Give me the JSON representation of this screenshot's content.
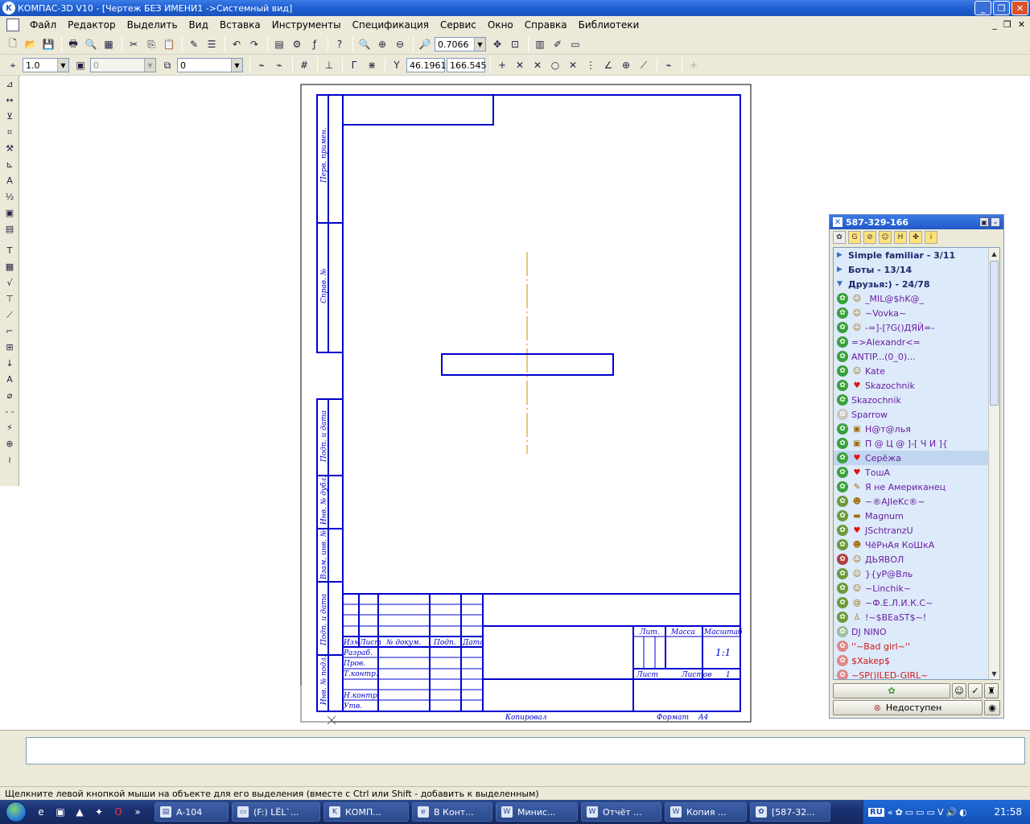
{
  "window": {
    "title": "КОМПАС-3D V10 - [Чертеж БЕЗ ИМЕНИ1 ->Системный вид]",
    "app_icon": "K"
  },
  "menu": [
    "Файл",
    "Редактор",
    "Выделить",
    "Вид",
    "Вставка",
    "Инструменты",
    "Спецификация",
    "Сервис",
    "Окно",
    "Справка",
    "Библиотеки"
  ],
  "toolbar1": {
    "zoom_value": "0.7066"
  },
  "toolbar2": {
    "step_value": "1.0",
    "layer_value": "0",
    "style_value": "0",
    "coord_x": "46.1961",
    "coord_y": "166.545"
  },
  "drawing": {
    "stamp": {
      "side_labels": [
        "Перв. примен.",
        "Справ. №",
        "Подп. и дата",
        "Инв. № дубл.",
        "Взам. инв. №",
        "Подп. и дата",
        "Инв. № подл."
      ],
      "rows": [
        "Изм",
        "Лист",
        "№ докум.",
        "Подп.",
        "Дата"
      ],
      "left_labels": [
        "Разраб.",
        "Пров.",
        "Т.контр.",
        "Н.контр.",
        "Утв."
      ],
      "lit": "Лит.",
      "mass": "Масса",
      "scale": "Масштаб",
      "scale_value": "1:1",
      "sheet": "Лист",
      "sheets": "Листов",
      "sheets_value": "1",
      "copied": "Копировал",
      "format": "Формат",
      "format_value": "A4"
    }
  },
  "status": {
    "hint": "Щелкните левой кнопкой мыши на объекте для его выделения (вместе с Ctrl или Shift - добавить к выделенным)"
  },
  "icq": {
    "uin": "587-329-166",
    "groups": [
      {
        "label": "Simple familiar - 3/11",
        "expanded": false
      },
      {
        "label": "Боты - 13/14",
        "expanded": false
      },
      {
        "label": "Друзья:) - 24/78",
        "expanded": true
      }
    ],
    "contacts": [
      {
        "name": "_MIL@$hK@_",
        "color": "#6a1ea0",
        "status": "#3aa03a",
        "xs": "☺"
      },
      {
        "name": "~Vovka~",
        "color": "#6a1ea0",
        "status": "#3aa03a",
        "xs": "☺"
      },
      {
        "name": "-=]-[?G()ДЯЙ=-",
        "color": "#6a1ea0",
        "status": "#3aa03a",
        "xs": "☺"
      },
      {
        "name": "=>Alexandr<=",
        "color": "#6a1ea0",
        "status": "#3aa03a",
        "xs": ""
      },
      {
        "name": "ANTIP...(0_0)...",
        "color": "#6a1ea0",
        "status": "#3aa03a",
        "xs": ""
      },
      {
        "name": "Kate",
        "color": "#6a1ea0",
        "status": "#3aa03a",
        "xs": "☺"
      },
      {
        "name": "Skazochnik",
        "color": "#6a1ea0",
        "status": "#3aa03a",
        "xs": "♥"
      },
      {
        "name": "Skazochnik",
        "color": "#6a1ea0",
        "status": "#3aa03a",
        "xs": ""
      },
      {
        "name": "Sparrow",
        "color": "#6a1ea0",
        "status": "#c8c8c0",
        "xs": ""
      },
      {
        "name": "Н@т@лья",
        "color": "#6a1ea0",
        "status": "#3aa03a",
        "xs": "▣"
      },
      {
        "name": "П @ Ц @ ]-[ Ч И ]{",
        "color": "#6a1ea0",
        "status": "#3aa03a",
        "xs": "▣"
      },
      {
        "name": "Серёжа",
        "color": "#6a1ea0",
        "status": "#3aa03a",
        "xs": "♥",
        "selected": true
      },
      {
        "name": "ТошА",
        "color": "#6a1ea0",
        "status": "#3aa03a",
        "xs": "♥"
      },
      {
        "name": "Я не Американец",
        "color": "#6a1ea0",
        "status": "#3aa03a",
        "xs": "✎"
      },
      {
        "name": "~®AJIeKc®~",
        "color": "#6a1ea0",
        "status": "#6a9a3a",
        "xs": "☻"
      },
      {
        "name": "Magnum",
        "color": "#6a1ea0",
        "status": "#6a9a3a",
        "xs": "▬"
      },
      {
        "name": "JSchtranzU",
        "color": "#6a1ea0",
        "status": "#6a9a3a",
        "xs": "♥"
      },
      {
        "name": "ЧёРнАя КоШкА",
        "color": "#6a1ea0",
        "status": "#6a9a3a",
        "xs": "☻"
      },
      {
        "name": "ДЬЯВОЛ",
        "color": "#6a1ea0",
        "status": "#b04040",
        "xs": "☺"
      },
      {
        "name": "}{уР@Вль",
        "color": "#6a1ea0",
        "status": "#6a9a3a",
        "xs": "☺"
      },
      {
        "name": "~Linchik~",
        "color": "#6a1ea0",
        "status": "#6a9a3a",
        "xs": "☺"
      },
      {
        "name": "~Ф.Е.Л.И.К.С~",
        "color": "#6a1ea0",
        "status": "#6a9a3a",
        "xs": "@"
      },
      {
        "name": "!~$BEaST$~!",
        "color": "#6a1ea0",
        "status": "#6a9a3a",
        "xs": "♙"
      },
      {
        "name": "DJ NINO",
        "color": "#6a1ea0",
        "status": "#a0c0a0",
        "xs": ""
      },
      {
        "name": "''~Bad girl~''",
        "color": "#d01818",
        "status": "#e08888",
        "xs": ""
      },
      {
        "name": "$Xakep$",
        "color": "#d01818",
        "status": "#e08888",
        "xs": ""
      },
      {
        "name": "~SP()ILED-GIRL~",
        "color": "#d01818",
        "status": "#e08888",
        "xs": ""
      }
    ],
    "status_button": "Недоступен"
  },
  "taskbar": {
    "tasks": [
      {
        "label": "A-104",
        "icon": "▤"
      },
      {
        "label": "(F:) LЁL`...",
        "icon": "▭"
      },
      {
        "label": "КОМП...",
        "icon": "K"
      },
      {
        "label": "В Конт...",
        "icon": "e"
      },
      {
        "label": "Минис...",
        "icon": "W"
      },
      {
        "label": "Отчёт ...",
        "icon": "W"
      },
      {
        "label": "Копия ...",
        "icon": "W"
      },
      {
        "label": "[587-32...",
        "icon": "✿"
      }
    ],
    "lang": "RU",
    "clock": "21:58"
  }
}
